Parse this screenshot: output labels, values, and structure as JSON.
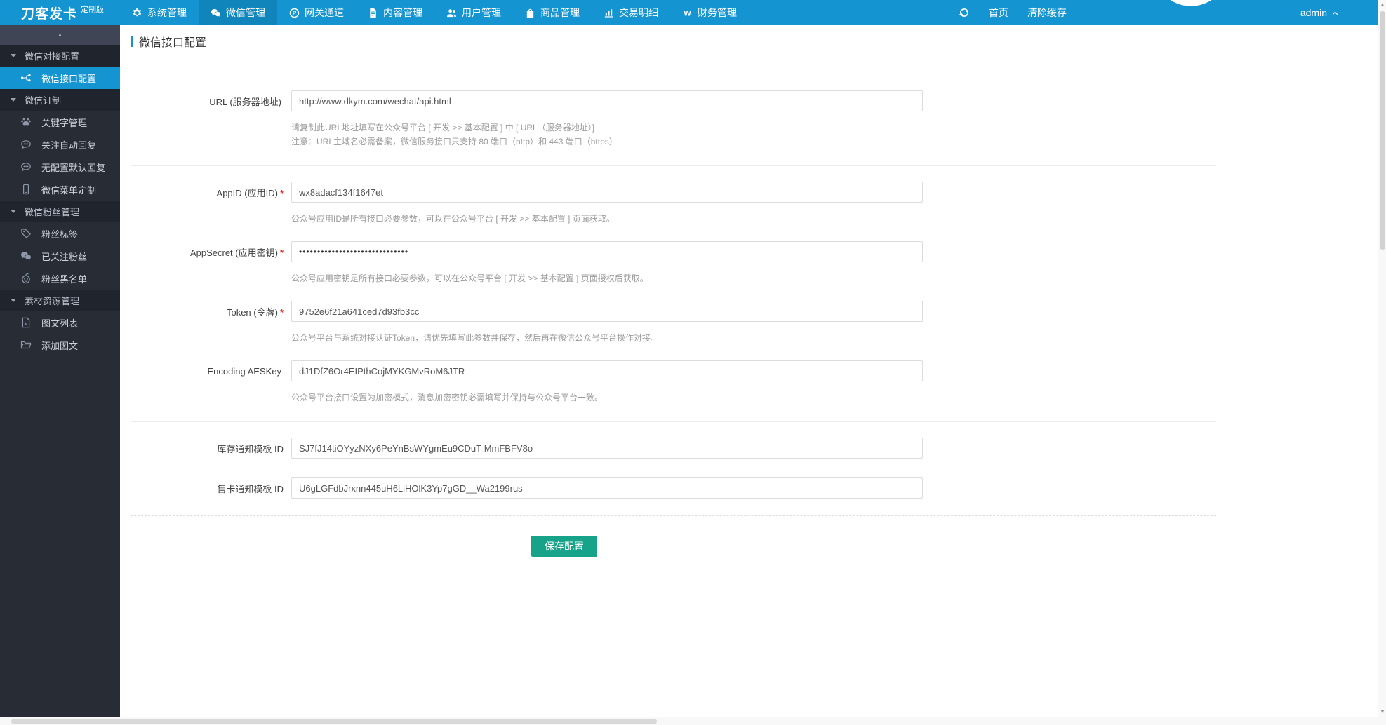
{
  "topbar": {
    "logo": "刀客发卡",
    "logo_badge": "定制版",
    "nav": [
      {
        "label": "系统管理",
        "icon": "gear-icon",
        "active": false
      },
      {
        "label": "微信管理",
        "icon": "wechat-icon",
        "active": true
      },
      {
        "label": "网关通道",
        "icon": "gateway-p-icon",
        "active": false
      },
      {
        "label": "内容管理",
        "icon": "document-icon",
        "active": false
      },
      {
        "label": "用户管理",
        "icon": "users-icon",
        "active": false
      },
      {
        "label": "商品管理",
        "icon": "shopping-bag-icon",
        "active": false
      },
      {
        "label": "交易明细",
        "icon": "bar-chart-icon",
        "active": false
      },
      {
        "label": "财务管理",
        "icon": "finance-icon",
        "active": false
      }
    ],
    "right": {
      "refresh_icon": "refresh-icon",
      "home": "首页",
      "clear_cache": "清除缓存",
      "user_icon": "person-icon",
      "user": "admin",
      "chevron_icon": "chevron-up-icon"
    }
  },
  "sidebar": {
    "sections": [
      {
        "title": "微信对接配置",
        "items": [
          {
            "label": "微信接口配置",
            "icon": "share-nodes-icon",
            "active": true
          }
        ]
      },
      {
        "title": "微信订制",
        "items": [
          {
            "label": "关键字管理",
            "icon": "paw-icon"
          },
          {
            "label": "关注自动回复",
            "icon": "comment-icon"
          },
          {
            "label": "无配置默认回复",
            "icon": "comment-icon"
          },
          {
            "label": "微信菜单定制",
            "icon": "mobile-icon"
          }
        ]
      },
      {
        "title": "微信粉丝管理",
        "items": [
          {
            "label": "粉丝标签",
            "icon": "tag-icon"
          },
          {
            "label": "已关注粉丝",
            "icon": "wechat-icon"
          },
          {
            "label": "粉丝黑名单",
            "icon": "robot-icon"
          }
        ]
      },
      {
        "title": "素材资源管理",
        "items": [
          {
            "label": "图文列表",
            "icon": "file-icon"
          },
          {
            "label": "添加图文",
            "icon": "folder-open-icon"
          }
        ]
      }
    ]
  },
  "page": {
    "title": "微信接口配置",
    "form": {
      "fields": [
        {
          "label": "URL (服务器地址)",
          "req": "",
          "value": "http://www.dkym.com/wechat/api.html",
          "help": [
            "请复制此URL地址填写在公众号平台 [ 开发 >> 基本配置 ] 中 [ URL（服务器地址）]",
            "注意：URL主域名必需备案，微信服务接口只支持 80 端口（http）和 443 端口（https）"
          ]
        },
        {
          "label": "AppID (应用ID)",
          "req": "*",
          "value": "wx8adacf134f1647et",
          "help": [
            "公众号应用ID是所有接口必要参数，可以在公众号平台 [ 开发 >> 基本配置 ] 页面获取。"
          ]
        },
        {
          "label": "AppSecret (应用密钥)",
          "req": "*",
          "value": "••••••••••••••••••••••••••••••",
          "help": [
            "公众号应用密钥是所有接口必要参数，可以在公众号平台 [ 开发 >> 基本配置 ] 页面授权后获取。"
          ]
        },
        {
          "label": "Token (令牌)",
          "req": "*",
          "value": "9752e6f21a641ced7d93fb3cc",
          "help": [
            "公众号平台与系统对接认证Token，请优先填写此参数并保存，然后再在微信公众号平台操作对接。"
          ]
        },
        {
          "label": "Encoding AESKey",
          "req": "",
          "value": "dJ1DfZ6Or4EIPthCojMYKGMvRoM6JTR",
          "help": [
            "公众号平台接口设置为加密模式，消息加密密钥必需填写并保持与公众号平台一致。"
          ]
        },
        {
          "label": "库存通知模板 ID",
          "req": "",
          "value": "SJ7fJ14tiOYyzNXy6PeYnBsWYgmEu9CDuT-MmFBFV8o",
          "help": []
        },
        {
          "label": "售卡通知模板 ID",
          "req": "",
          "value": "U6gLGFdbJrxnn445uH6LiHOlK3Yp7gGD__Wa2199rus",
          "help": []
        }
      ],
      "save_label": "保存配置"
    }
  },
  "colors": {
    "accent": "#1494d0",
    "topnav_active": "#0f85bc",
    "sidebar_bg": "#272c35",
    "save_button": "#16a389",
    "required": "#e5302c"
  }
}
